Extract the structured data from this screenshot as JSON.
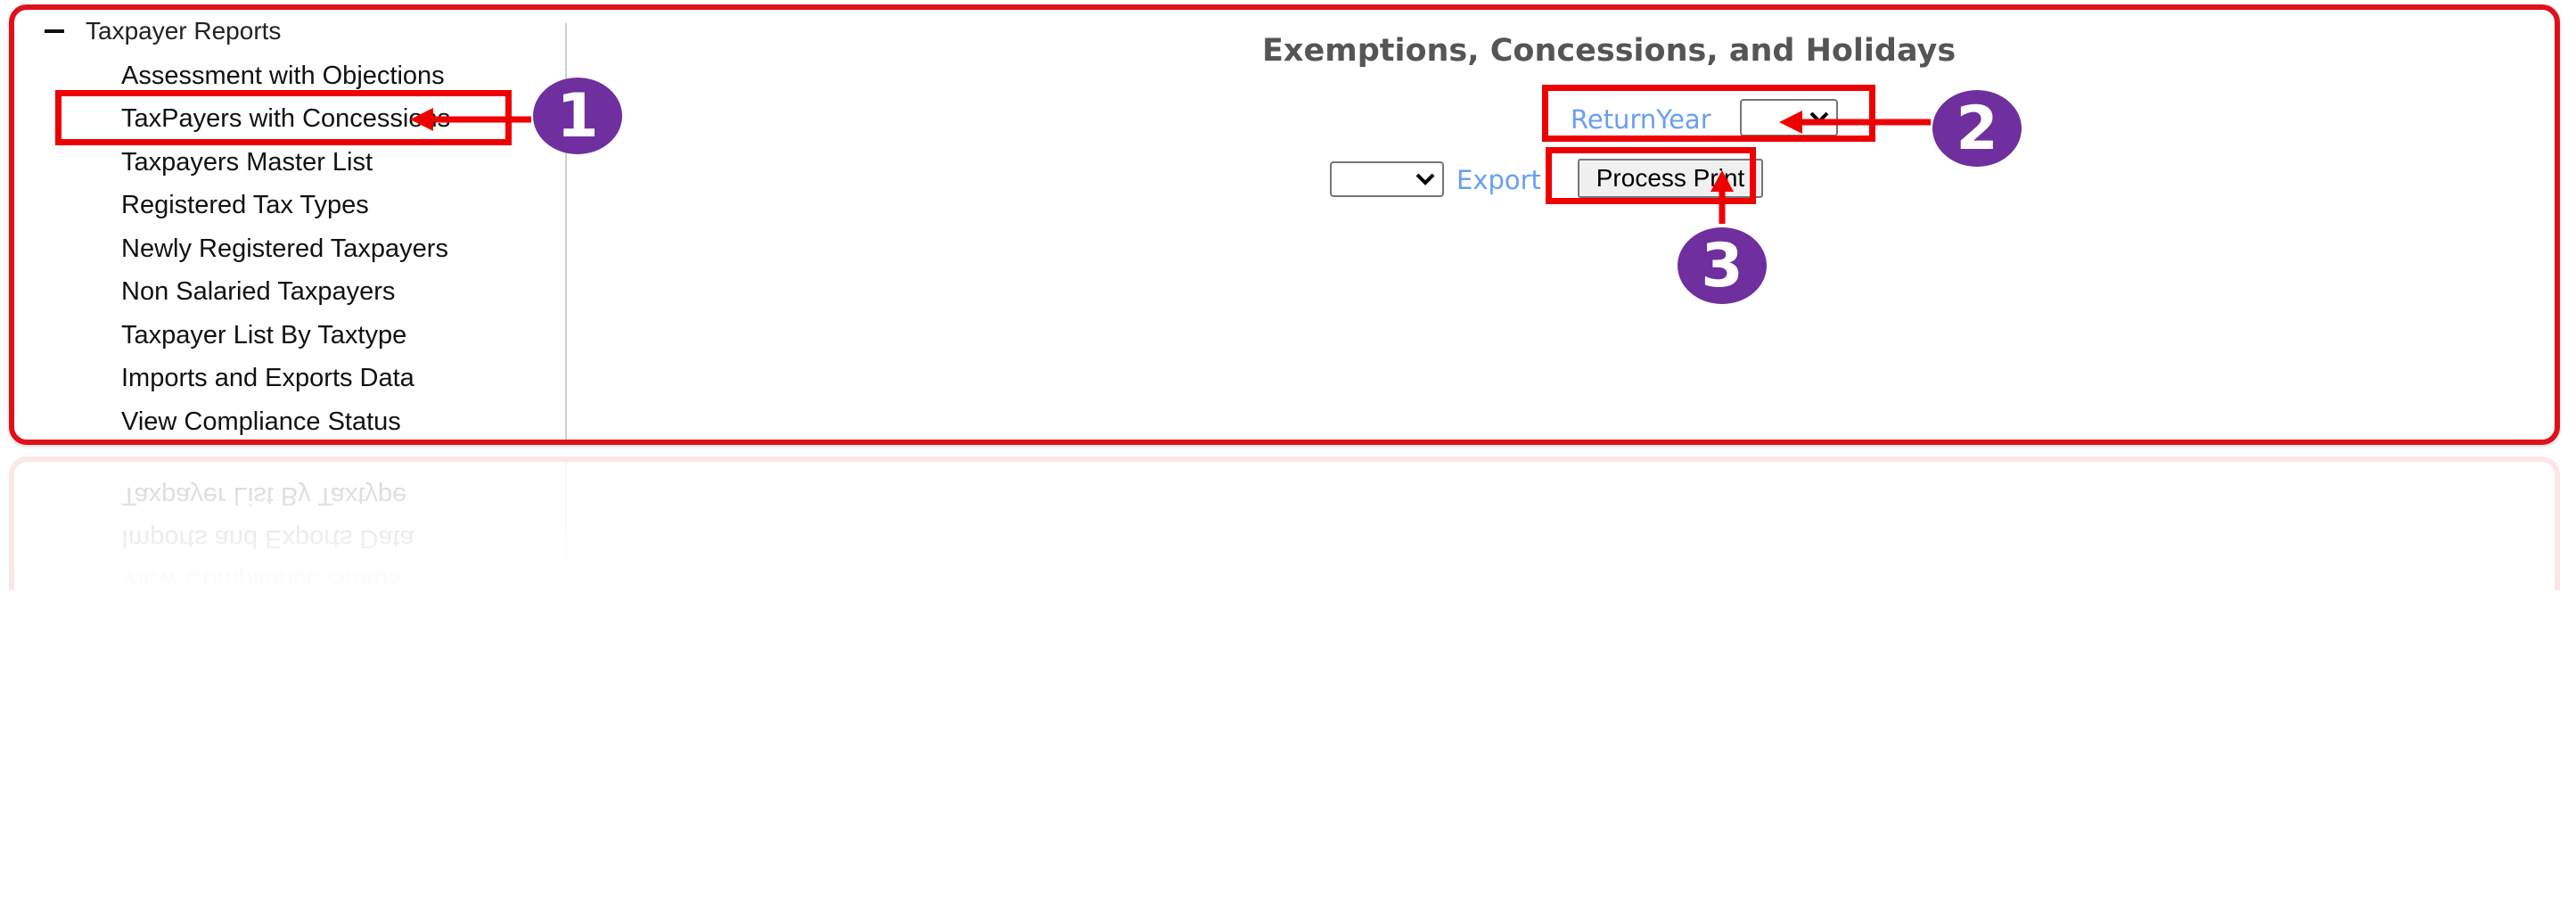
{
  "sidebar": {
    "group_label": "Taxpayer Reports",
    "items": [
      {
        "label": "Assessment with Objections"
      },
      {
        "label": "TaxPayers with Concessions"
      },
      {
        "label": "Taxpayers Master List"
      },
      {
        "label": "Registered Tax Types"
      },
      {
        "label": "Newly Registered Taxpayers"
      },
      {
        "label": "Non Salaried Taxpayers"
      },
      {
        "label": "Taxpayer List By Taxtype"
      },
      {
        "label": "Imports and Exports Data"
      },
      {
        "label": "View Compliance Status"
      }
    ]
  },
  "main": {
    "title": "Exemptions, Concessions, and Holidays",
    "return_year_label": "ReturnYear",
    "return_year_value": "",
    "export_label": "Export",
    "export_format_value": "",
    "process_print_label": "Process Print"
  },
  "annotations": {
    "step1": "1",
    "step2": "2",
    "step3": "3",
    "highlight_color": "#ee0000",
    "badge_color": "#6f2f9f"
  }
}
